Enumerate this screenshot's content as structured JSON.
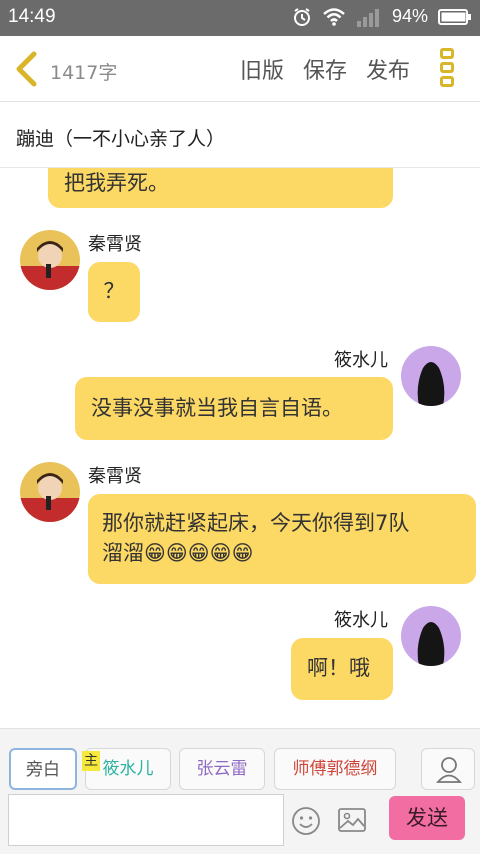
{
  "status": {
    "time": "14:49",
    "battery": "94%"
  },
  "header": {
    "char_count": "1417字",
    "old_version": "旧版",
    "save": "保存",
    "publish": "发布"
  },
  "story_title": "蹦迪（一不小心亲了人）",
  "messages": [
    {
      "side": "left",
      "text": "把我弄死。"
    },
    {
      "side": "left",
      "name": "秦霄贤",
      "text": "？"
    },
    {
      "side": "right",
      "name": "筱水儿",
      "text": "没事没事就当我自言自语。"
    },
    {
      "side": "left",
      "name": "秦霄贤",
      "text_line1": "那你就赶紧起床，今天你得到7队",
      "text_line2": "溜溜😁😁😁😁😁"
    },
    {
      "side": "right",
      "name": "筱水儿",
      "text": "啊！哦"
    }
  ],
  "roles": {
    "narration": "旁白",
    "host_tag": "主",
    "role1": "筱水儿",
    "role2": "张云雷",
    "role3": "师傅郭德纲"
  },
  "colors": {
    "bubble": "#fcd864",
    "accent": "#d9b52a",
    "send": "#f26ea2",
    "role1": "#2bb3a0",
    "role2": "#8e6bc2",
    "role3": "#d0453a"
  },
  "input": {
    "placeholder": "",
    "send_label": "发送"
  },
  "icons": [
    "back-chevron-icon",
    "alarm-icon",
    "wifi-icon",
    "signal-icon",
    "battery-icon",
    "menu-icon",
    "person-icon",
    "emoji-icon",
    "image-icon"
  ]
}
